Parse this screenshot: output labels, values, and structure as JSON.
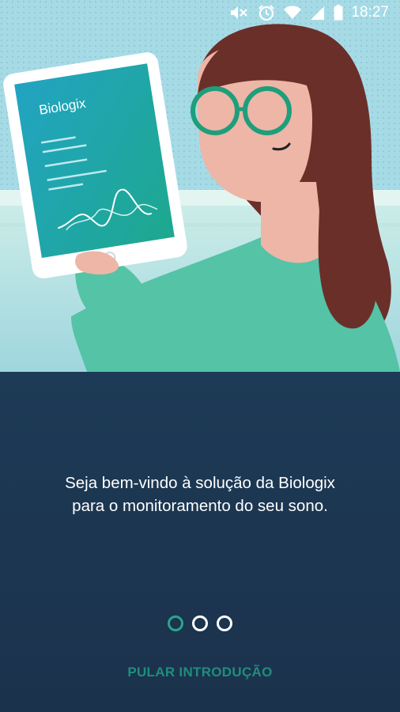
{
  "status_bar": {
    "time": "18:27",
    "icons": [
      "mute-icon",
      "alarm-icon",
      "wifi-icon",
      "signal-icon",
      "battery-icon"
    ]
  },
  "hero": {
    "tablet_brand": "Biologix"
  },
  "onboarding": {
    "message_line1": "Seja bem-vindo à solução da Biologix",
    "message_line2": "para o monitoramento do seu sono.",
    "pages_total": 3,
    "current_page": 1,
    "skip_label": "PULAR INTRODUÇÃO"
  },
  "colors": {
    "background": "#1b3550",
    "accent": "#2aa58c",
    "skip_text": "#1f8e7b",
    "hair": "#6b2f2a",
    "shirt": "#55c3a6"
  }
}
